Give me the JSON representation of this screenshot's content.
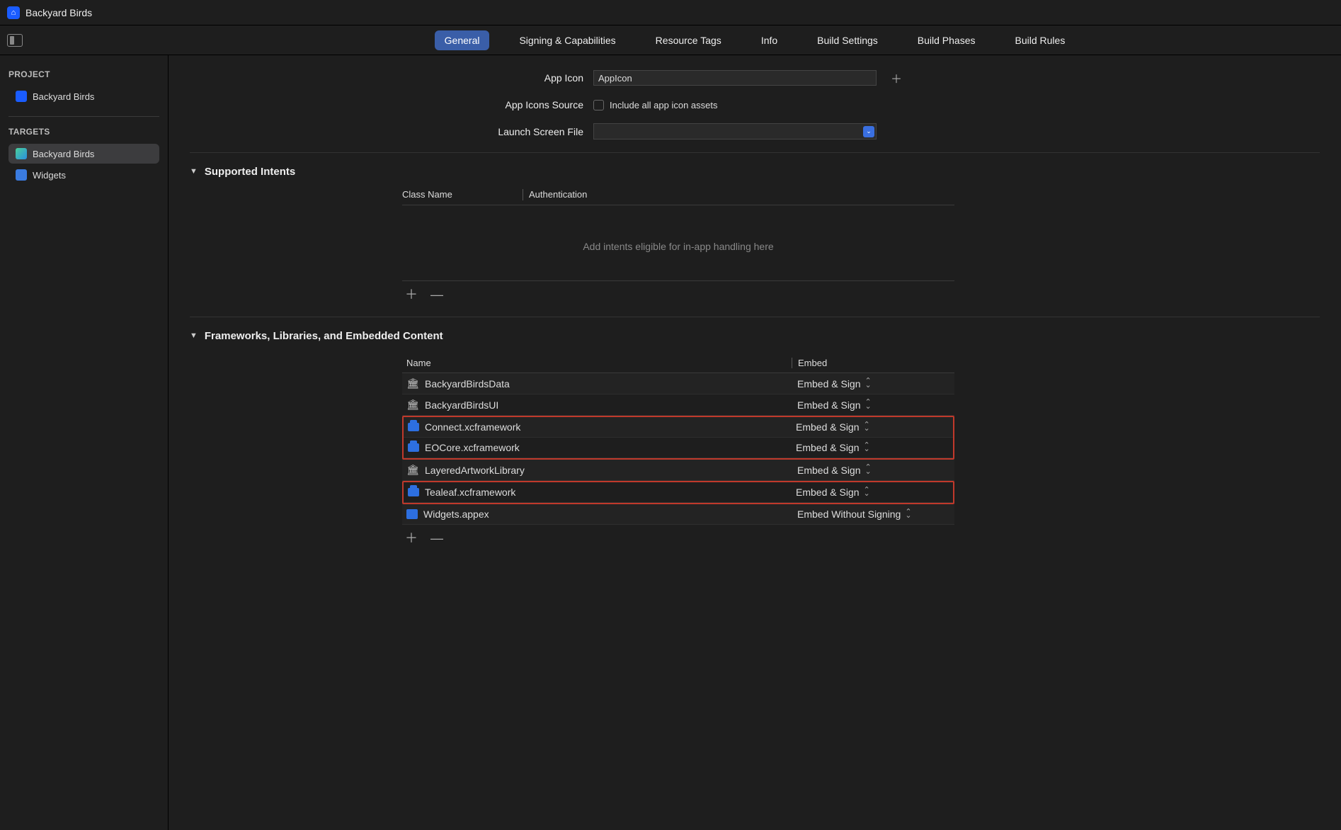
{
  "titlebar": {
    "title": "Backyard Birds"
  },
  "tabs": [
    {
      "label": "General",
      "active": true
    },
    {
      "label": "Signing & Capabilities"
    },
    {
      "label": "Resource Tags"
    },
    {
      "label": "Info"
    },
    {
      "label": "Build Settings"
    },
    {
      "label": "Build Phases"
    },
    {
      "label": "Build Rules"
    }
  ],
  "sidebar": {
    "project_heading": "PROJECT",
    "project_name": "Backyard Birds",
    "targets_heading": "TARGETS",
    "targets": [
      {
        "name": "Backyard Birds",
        "selected": true
      },
      {
        "name": "Widgets"
      }
    ]
  },
  "form": {
    "app_icon_label": "App Icon",
    "app_icon_value": "AppIcon",
    "icons_source_label": "App Icons Source",
    "icons_source_checkbox": "Include all app icon assets",
    "launch_file_label": "Launch Screen File",
    "launch_file_value": ""
  },
  "intents": {
    "title": "Supported Intents",
    "col_class": "Class Name",
    "col_auth": "Authentication",
    "empty": "Add intents eligible for in-app handling here"
  },
  "frameworks": {
    "title": "Frameworks, Libraries, and Embedded Content",
    "col_name": "Name",
    "col_embed": "Embed",
    "rows": [
      {
        "name": "BackyardBirdsData",
        "embed": "Embed & Sign",
        "icon": "lib",
        "hl": 0
      },
      {
        "name": "BackyardBirdsUI",
        "embed": "Embed & Sign",
        "icon": "lib",
        "hl": 0
      },
      {
        "name": "Connect.xcframework",
        "embed": "Embed & Sign",
        "icon": "fw",
        "hl": 1
      },
      {
        "name": "EOCore.xcframework",
        "embed": "Embed & Sign",
        "icon": "fw",
        "hl": 1
      },
      {
        "name": "LayeredArtworkLibrary",
        "embed": "Embed & Sign",
        "icon": "lib",
        "hl": 0
      },
      {
        "name": "Tealeaf.xcframework",
        "embed": "Embed & Sign",
        "icon": "fw",
        "hl": 2
      },
      {
        "name": "Widgets.appex",
        "embed": "Embed Without Signing",
        "icon": "appex",
        "hl": 0
      }
    ]
  }
}
